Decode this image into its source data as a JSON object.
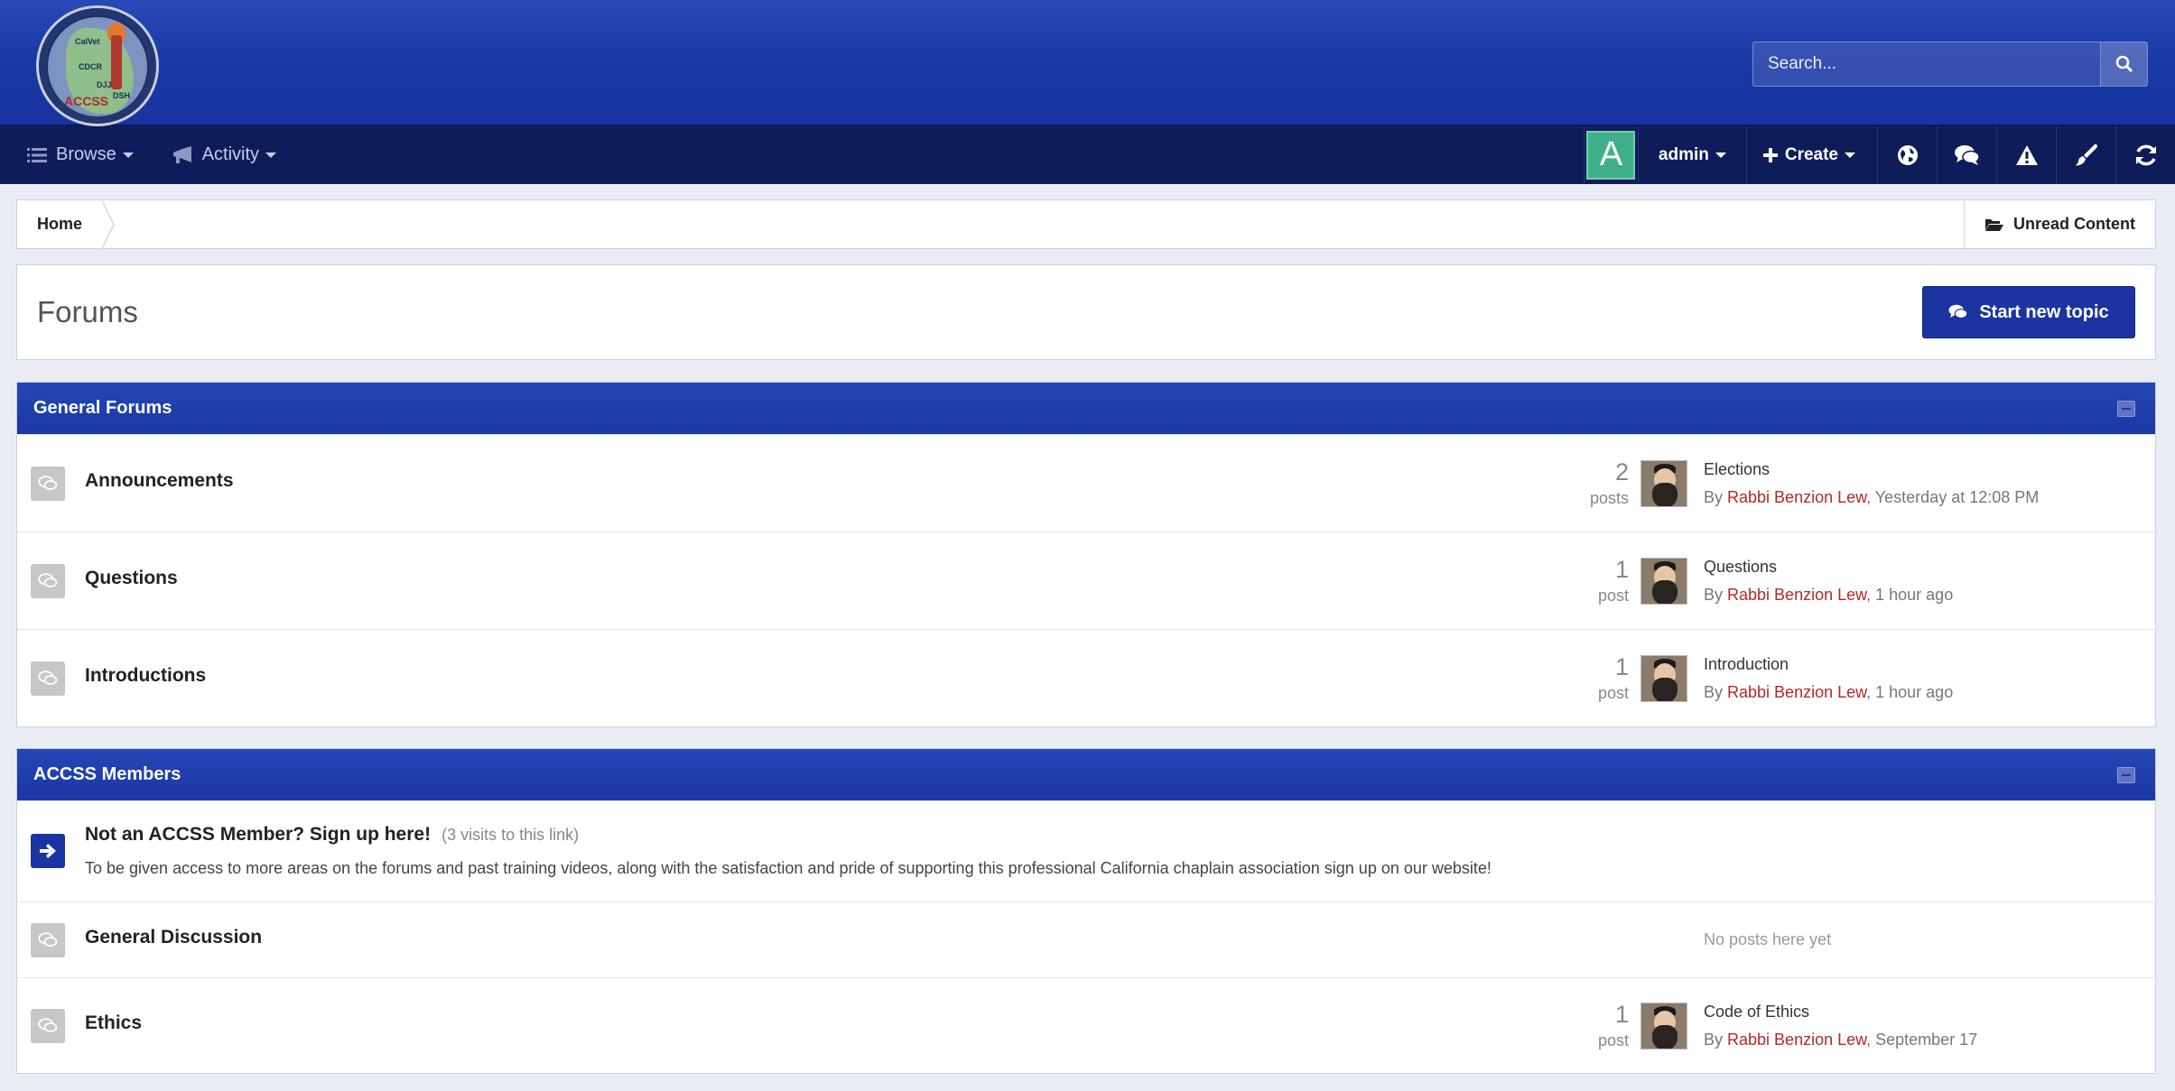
{
  "header": {
    "logo_alt": "ACCSS logo",
    "logo_labels": [
      "CalVet",
      "CDCR",
      "DSH",
      "DJJ",
      "ACCSS"
    ],
    "search": {
      "placeholder": "Search..."
    }
  },
  "nav": {
    "browse": "Browse",
    "activity": "Activity",
    "avatar_letter": "A",
    "user": "admin",
    "create": "Create"
  },
  "breadcrumb": {
    "home": "Home",
    "unread": "Unread Content"
  },
  "page": {
    "title": "Forums",
    "new_topic": "Start new topic"
  },
  "categories": [
    {
      "title": "General Forums",
      "forums": [
        {
          "name": "Announcements",
          "count": "2",
          "count_label": "posts",
          "last_title": "Elections",
          "by": "By ",
          "author": "Rabbi Benzion Lew",
          "time": ", Yesterday at 12:08 PM"
        },
        {
          "name": "Questions",
          "count": "1",
          "count_label": "post",
          "last_title": "Questions",
          "by": "By ",
          "author": "Rabbi Benzion Lew",
          "time": ", 1 hour ago"
        },
        {
          "name": "Introductions",
          "count": "1",
          "count_label": "post",
          "last_title": "Introduction",
          "by": "By ",
          "author": "Rabbi Benzion Lew",
          "time": ", 1 hour ago"
        }
      ]
    },
    {
      "title": "ACCSS Members",
      "redirect": {
        "name": "Not an ACCSS Member? Sign up here!",
        "visits": "(3 visits to this link)",
        "description": "To be given access to more areas on the forums and past training videos, along with the satisfaction and pride of supporting this professional California chaplain association sign up on our website!"
      },
      "forums": [
        {
          "name": "General Discussion",
          "empty": "No posts here yet"
        },
        {
          "name": "Ethics",
          "count": "1",
          "count_label": "post",
          "last_title": "Code of Ethics",
          "by": "By ",
          "author": "Rabbi Benzion Lew",
          "time": ", September 17"
        }
      ]
    }
  ]
}
